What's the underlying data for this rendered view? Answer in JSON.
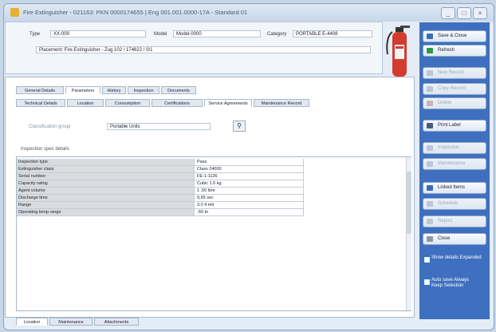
{
  "window": {
    "title": "Fire Extinguisher - 021163: PKN 0000174655 | Eng 001.001.0000-17A - Standard 01",
    "controls": [
      "_",
      "□",
      "×"
    ]
  },
  "header": {
    "fields": [
      {
        "label": "Type",
        "value": "XX-000"
      },
      {
        "label": "Model",
        "value": "Model-0000"
      },
      {
        "label": "Category",
        "value": "PORTABLE E-4408"
      }
    ],
    "description": "Placement: Fire Extinguisher - Zug 102 / 174622 / 0/1"
  },
  "tabs_main": [
    "General Details",
    "Parameters",
    "History",
    "Inspection",
    "Documents"
  ],
  "tabs_sub": [
    "Technical Details",
    "Location",
    "Consumption",
    "Certifications",
    "Service Agreements",
    "Maintenance Record"
  ],
  "selector": {
    "label": "Classification group",
    "value": "Portable Units",
    "button_icon": "search-icon"
  },
  "grid": {
    "caption": "Inspection spec details",
    "rows": [
      {
        "name": "Inspection type",
        "value": "Pass"
      },
      {
        "name": "Extinguisher class",
        "value": "Class 24000"
      },
      {
        "name": "Serial number",
        "value": "FE-1-1126"
      },
      {
        "name": "Capacity rating",
        "value": "Cubic 1.5 kg"
      },
      {
        "name": "Agent volume",
        "value": "1 ,50 litre"
      },
      {
        "name": "Discharge time",
        "value": "9,65 sec"
      },
      {
        "name": "Range",
        "value": "3.0 4 mtr"
      },
      {
        "name": "Operating temp range",
        "value": "-50 to"
      }
    ]
  },
  "sidebar": {
    "buttons": [
      {
        "label": "Save & Close",
        "icon": "save-icon",
        "disabled": false
      },
      {
        "label": "Refresh",
        "icon": "refresh-icon",
        "disabled": false
      },
      {
        "label": "New Record",
        "icon": "new-icon",
        "disabled": true
      },
      {
        "label": "Copy Record",
        "icon": "copy-icon",
        "disabled": true
      },
      {
        "label": "Delete",
        "icon": "delete-icon",
        "disabled": true
      },
      {
        "label": "Print Label",
        "icon": "print-icon",
        "disabled": false
      },
      {
        "label": "Inspection",
        "icon": "inspect-icon",
        "disabled": true
      },
      {
        "label": "Maintenance",
        "icon": "tools-icon",
        "disabled": true
      },
      {
        "label": "Linked Items",
        "icon": "link-icon",
        "disabled": false
      },
      {
        "label": "Schedule",
        "icon": "calendar-icon",
        "disabled": true
      },
      {
        "label": "Report",
        "icon": "report-icon",
        "disabled": true
      },
      {
        "label": "Close",
        "icon": "close-icon",
        "disabled": false
      }
    ],
    "checks": [
      {
        "label": "Show details Expanded"
      },
      {
        "label": "Auto save Always Keep Selection"
      }
    ]
  },
  "bottom_tabs": [
    "Location",
    "Maintenance",
    "Attachments"
  ],
  "colors": {
    "sidebar": "#3f6fbf",
    "accent": "#d43b2f"
  }
}
